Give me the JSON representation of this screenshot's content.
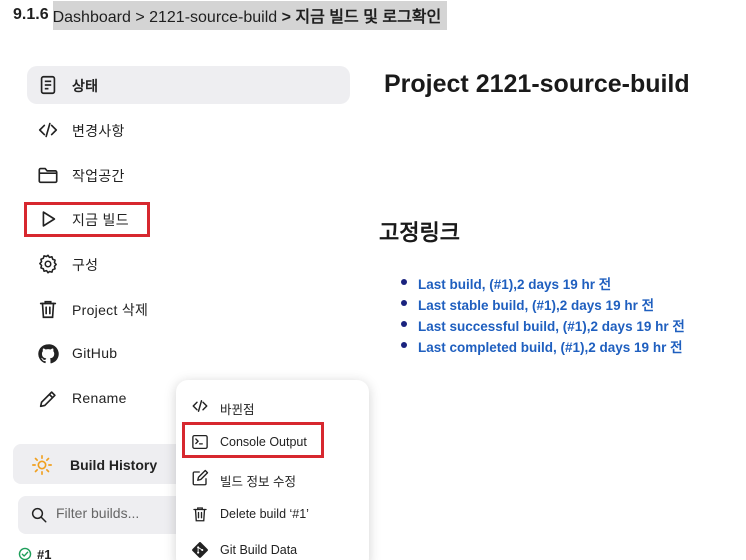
{
  "breadcrumb": {
    "section_num": "9.1.6",
    "dashboard": "Dashboard",
    "sep1": " > ",
    "project": "2121-source-build",
    "sep2": " > ",
    "current": "지금 빌드 및 로그확인"
  },
  "sidebar": {
    "items": [
      {
        "label": "상태",
        "icon": "status-icon"
      },
      {
        "label": "변경사항",
        "icon": "code-icon"
      },
      {
        "label": "작업공간",
        "icon": "folder-icon"
      },
      {
        "label": "지금 빌드",
        "icon": "play-icon"
      },
      {
        "label": "구성",
        "icon": "gear-icon"
      },
      {
        "label": "Project 삭제",
        "icon": "trash-icon"
      },
      {
        "label": "GitHub",
        "icon": "github-icon"
      },
      {
        "label": "Rename",
        "icon": "pencil-icon"
      }
    ]
  },
  "build_history": {
    "title": "Build History",
    "filter_placeholder": "Filter builds...",
    "first_build": "#1"
  },
  "main": {
    "title": "Project 2121-source-build",
    "permalinks_title": "고정링크",
    "permalinks": [
      "Last build, (#1),2 days 19 hr 전",
      "Last stable build, (#1),2 days 19 hr 전",
      "Last successful build, (#1),2 days 19 hr 전",
      "Last completed build, (#1),2 days 19 hr 전"
    ]
  },
  "dropdown": {
    "items": [
      {
        "label": "바뀐점",
        "icon": "code-icon"
      },
      {
        "label": "Console Output",
        "icon": "terminal-icon"
      },
      {
        "label": "빌드 정보 수정",
        "icon": "edit-icon"
      },
      {
        "label": "Delete build ‘#1’",
        "icon": "trash-icon"
      },
      {
        "label": "Git Build Data",
        "icon": "git-icon"
      }
    ]
  },
  "colors": {
    "link": "#1f5fbf",
    "highlight": "#d7282f",
    "panel_bg": "#eeeef1",
    "success": "#1e9e5a"
  }
}
